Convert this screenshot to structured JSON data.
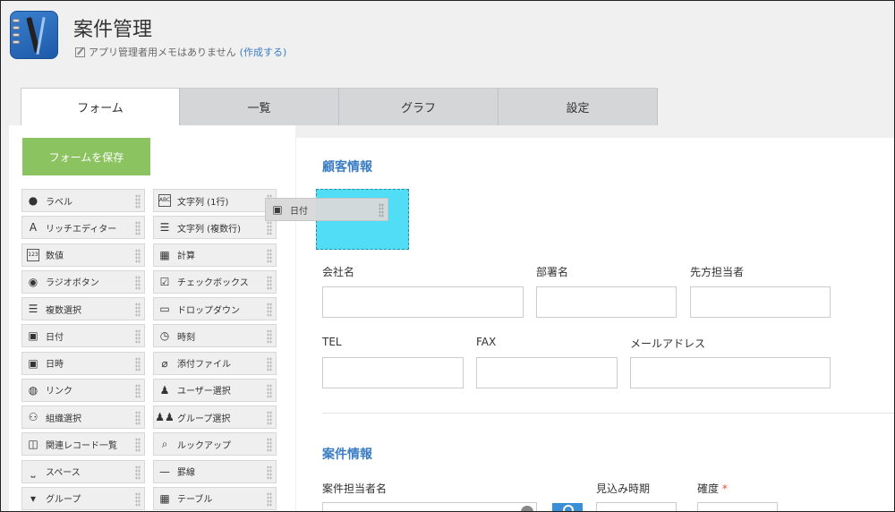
{
  "header": {
    "title": "案件管理",
    "memo_text": "アプリ管理者用メモはありません",
    "memo_link": "(作成する)"
  },
  "tabs": [
    {
      "label": "フォーム",
      "active": true
    },
    {
      "label": "一覧",
      "active": false
    },
    {
      "label": "グラフ",
      "active": false
    },
    {
      "label": "設定",
      "active": false
    }
  ],
  "palette": {
    "save_label": "フォームを保存",
    "items": [
      {
        "label": "ラベル",
        "icon": "tag-icon",
        "glyph": "●"
      },
      {
        "label": "文字列 (1行)",
        "icon": "abc-icon",
        "glyph": "ABC"
      },
      {
        "label": "リッチエディター",
        "icon": "rich-text-icon",
        "glyph": "A"
      },
      {
        "label": "文字列 (複数行)",
        "icon": "multiline-icon",
        "glyph": "☰"
      },
      {
        "label": "数値",
        "icon": "number-icon",
        "glyph": "123"
      },
      {
        "label": "計算",
        "icon": "calculator-icon",
        "glyph": "▦"
      },
      {
        "label": "ラジオボタン",
        "icon": "radio-icon",
        "glyph": "◉"
      },
      {
        "label": "チェックボックス",
        "icon": "checkbox-icon",
        "glyph": "☑"
      },
      {
        "label": "複数選択",
        "icon": "multi-select-icon",
        "glyph": "☰"
      },
      {
        "label": "ドロップダウン",
        "icon": "dropdown-icon",
        "glyph": "▭"
      },
      {
        "label": "日付",
        "icon": "calendar-icon",
        "glyph": "▣"
      },
      {
        "label": "時刻",
        "icon": "clock-icon",
        "glyph": "◷"
      },
      {
        "label": "日時",
        "icon": "datetime-icon",
        "glyph": "▣"
      },
      {
        "label": "添付ファイル",
        "icon": "paperclip-icon",
        "glyph": "⌀"
      },
      {
        "label": "リンク",
        "icon": "globe-icon",
        "glyph": "◍"
      },
      {
        "label": "ユーザー選択",
        "icon": "user-icon",
        "glyph": "♟"
      },
      {
        "label": "組織選択",
        "icon": "org-icon",
        "glyph": "⚇"
      },
      {
        "label": "グループ選択",
        "icon": "group-icon",
        "glyph": "♟♟"
      },
      {
        "label": "関連レコード一覧",
        "icon": "related-records-icon",
        "glyph": "◫"
      },
      {
        "label": "ルックアップ",
        "icon": "lookup-icon",
        "glyph": "⌕"
      },
      {
        "label": "スペース",
        "icon": "space-icon",
        "glyph": "⎵"
      },
      {
        "label": "罫線",
        "icon": "line-icon",
        "glyph": "—"
      },
      {
        "label": "グループ",
        "icon": "group-box-icon",
        "glyph": "▾"
      },
      {
        "label": "テーブル",
        "icon": "table-icon",
        "glyph": "▦"
      }
    ]
  },
  "drag_ghost": {
    "label": "日付",
    "icon": "calendar-icon",
    "glyph": "▣"
  },
  "form": {
    "section1": "顧客情報",
    "fields1": [
      {
        "label": "会社名"
      },
      {
        "label": "部署名"
      },
      {
        "label": "先方担当者"
      }
    ],
    "fields2": [
      {
        "label": "TEL"
      },
      {
        "label": "FAX"
      },
      {
        "label": "メールアドレス"
      }
    ],
    "section2": "案件情報",
    "fields3": [
      {
        "label": "案件担当者名"
      },
      {
        "label": "見込み時期"
      },
      {
        "label": "確度",
        "required_mark": "*"
      }
    ]
  },
  "colors": {
    "accent": "#3b7dc4",
    "save_button": "#8bc360",
    "drop_highlight": "#51ddf6",
    "required": "#e74c3c"
  }
}
